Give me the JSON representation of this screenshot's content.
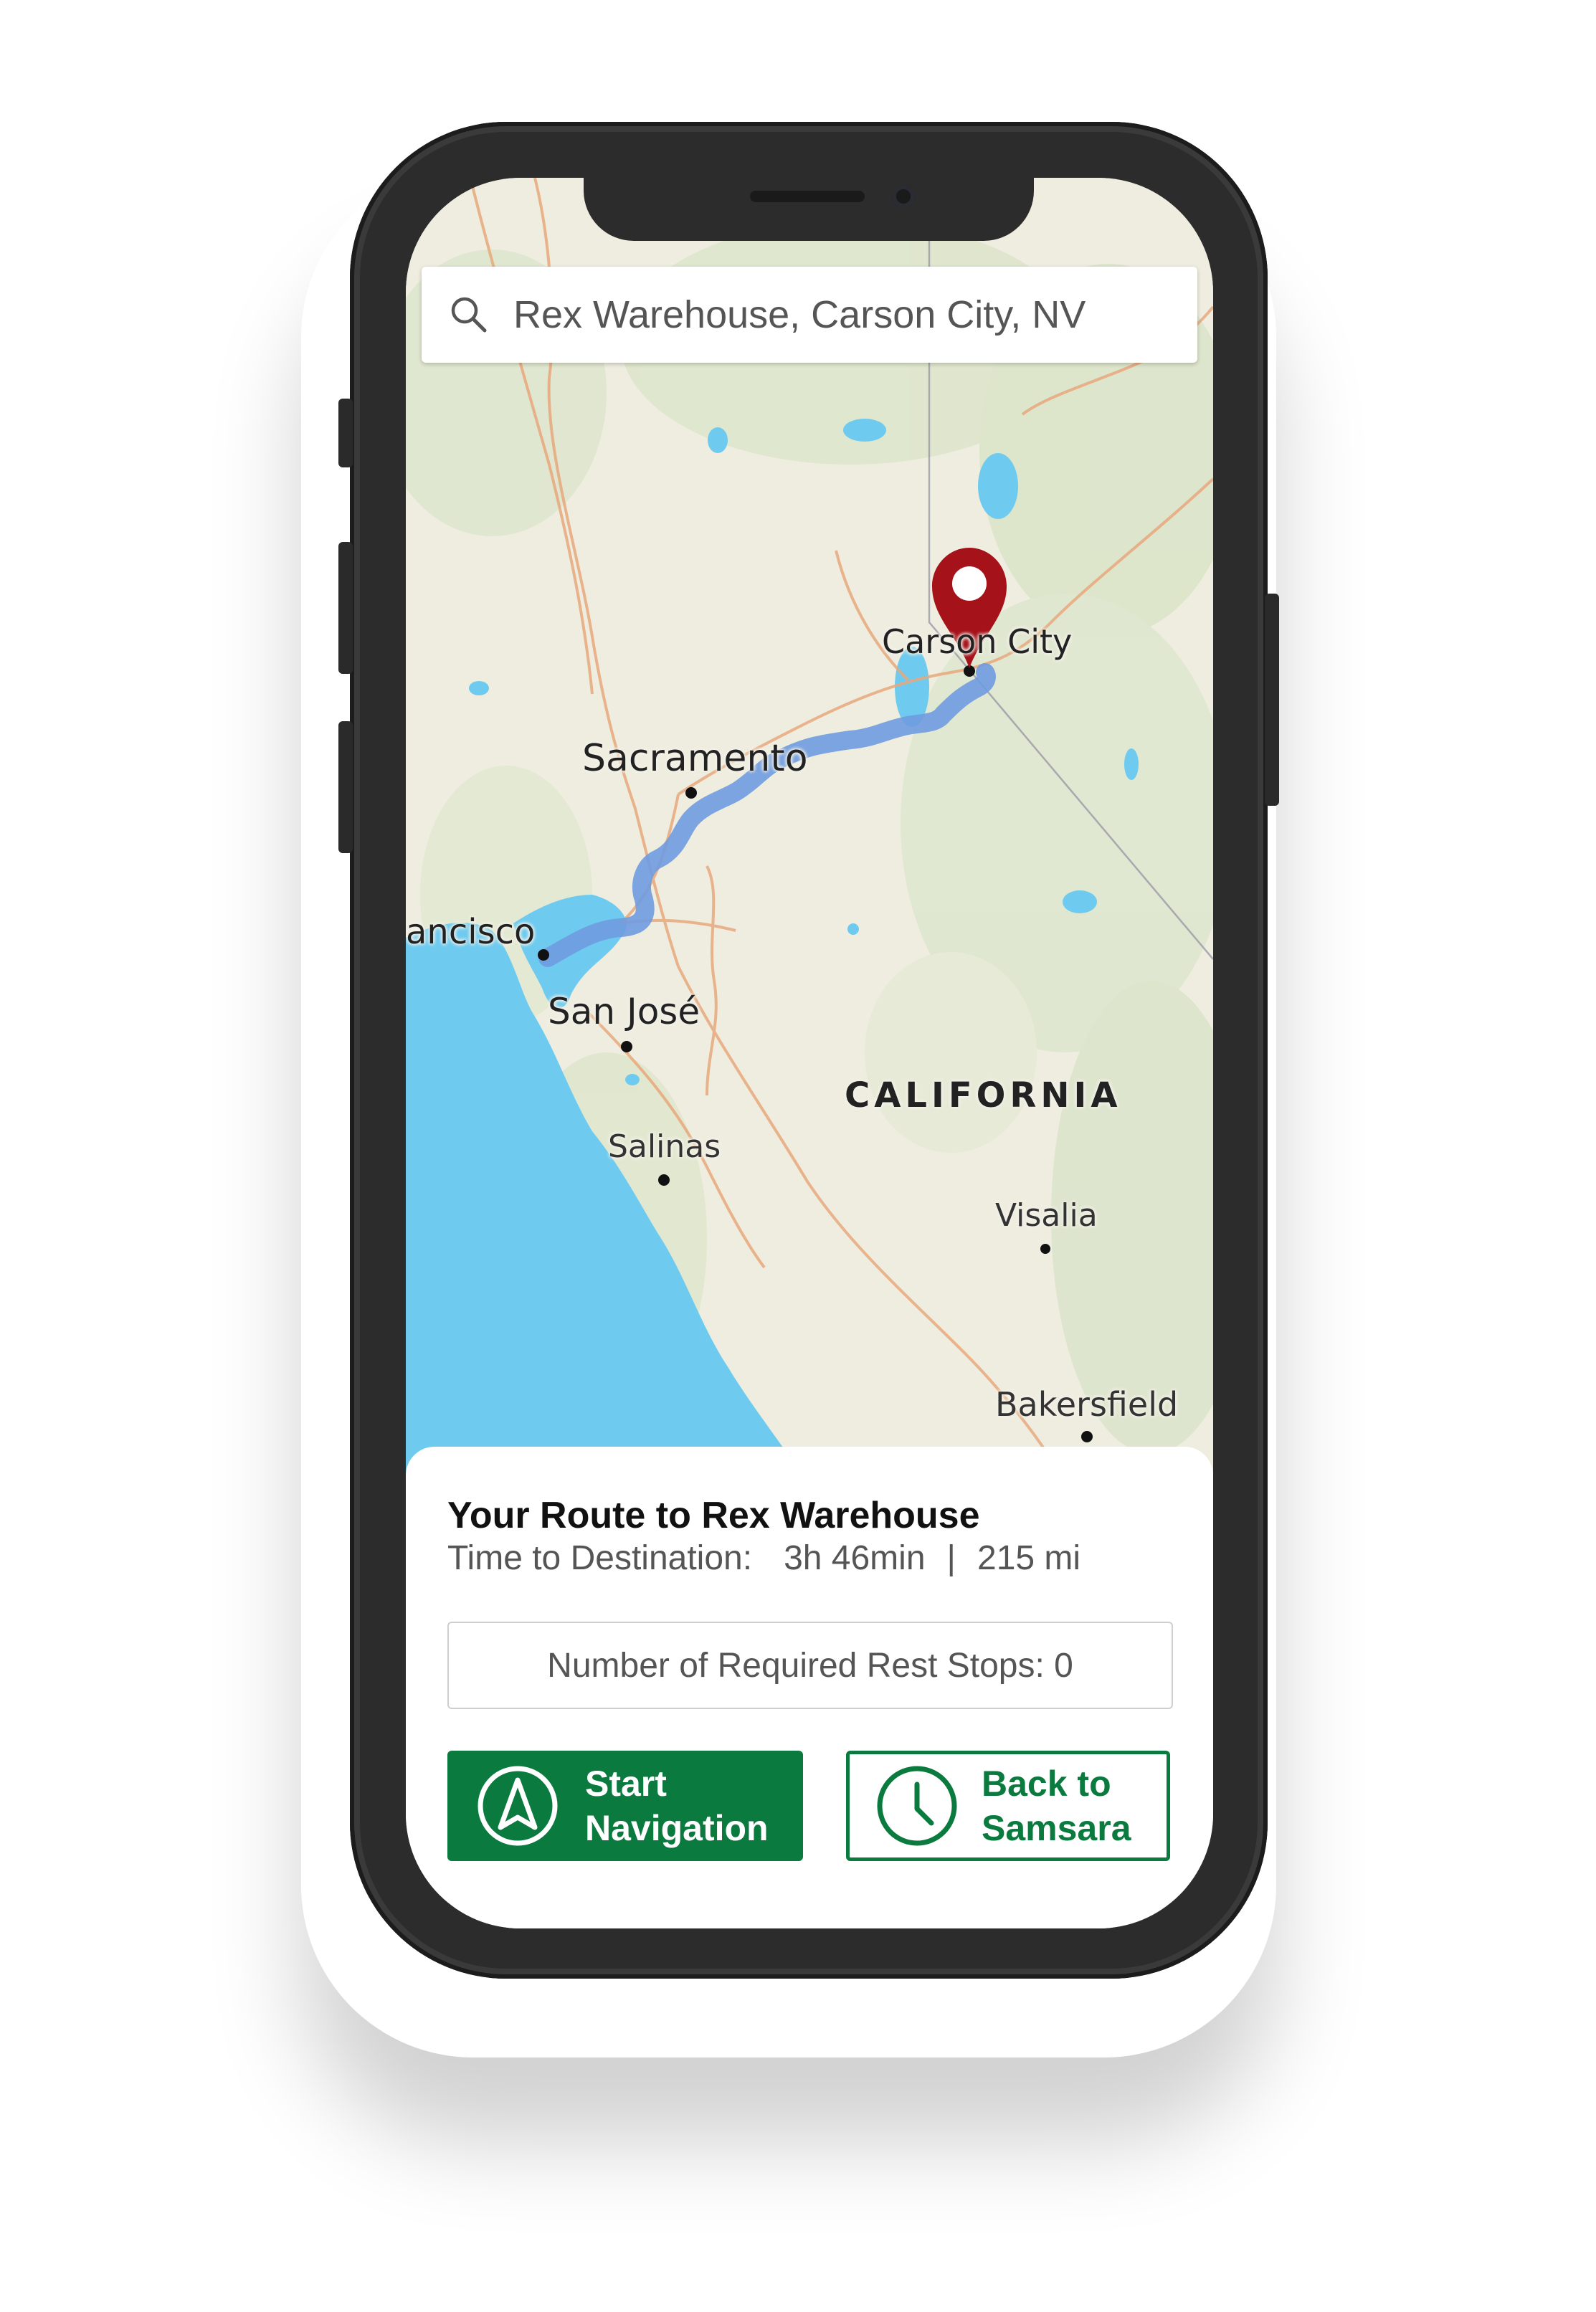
{
  "search": {
    "icon": "search-icon",
    "value": "Rex Warehouse, Carson City, NV"
  },
  "map": {
    "labels": {
      "carson_city": "Carson City",
      "sacramento": "Sacramento",
      "san_francisco": "ancisco",
      "san_jose": "San José",
      "california": "CALIFORNIA",
      "salinas": "Salinas",
      "visalia": "Visalia",
      "bakersfield": "Bakersfield"
    },
    "destination_pin_color": "#a5121a",
    "route_color": "#6f9be0"
  },
  "route": {
    "title": "Your Route to Rex Warehouse",
    "time_label": "Time to Destination:",
    "time_value": "3h 46min",
    "separator": "|",
    "distance": "215 mi",
    "rest_stops": "Number of Required Rest Stops: 0"
  },
  "buttons": {
    "start_navigation": {
      "label": "Start\nNavigation",
      "icon": "navigation-arrow-icon"
    },
    "back_to_samsara": {
      "label": "Back to\nSamsara",
      "icon": "clock-icon"
    }
  },
  "colors": {
    "brand_green": "#0b7a3e",
    "phone_body": "#2c2c2c"
  }
}
